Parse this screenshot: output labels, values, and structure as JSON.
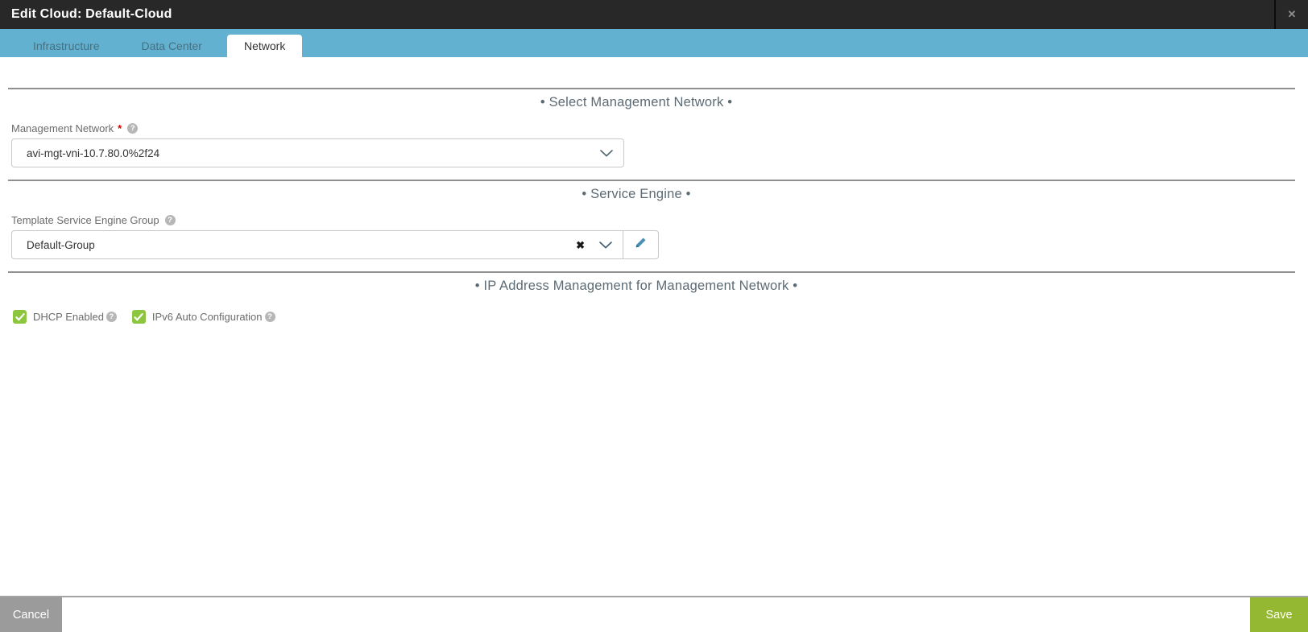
{
  "modal": {
    "title": "Edit Cloud: Default-Cloud"
  },
  "icons": {
    "close": "✕",
    "clear": "✖",
    "help": "?"
  },
  "tabs": [
    {
      "label": "Infrastructure",
      "active": false
    },
    {
      "label": "Data Center",
      "active": false
    },
    {
      "label": "Network",
      "active": true
    }
  ],
  "sections": {
    "select_management_network": {
      "heading": "• Select Management Network •",
      "field": {
        "label": "Management Network",
        "required_marker": "*",
        "value": "avi-mgt-vni-10.7.80.0%2f24"
      }
    },
    "service_engine": {
      "heading": "• Service Engine •",
      "field": {
        "label": "Template Service Engine Group",
        "value": "Default-Group"
      }
    },
    "ip_address_management": {
      "heading": "• IP Address Management for Management Network •",
      "checkboxes": [
        {
          "label": "DHCP Enabled",
          "checked": true
        },
        {
          "label": "IPv6 Auto Configuration",
          "checked": true
        }
      ]
    }
  },
  "footer": {
    "cancel_label": "Cancel",
    "save_label": "Save"
  },
  "colors": {
    "titlebar_bg": "#282828",
    "tabbar_bg": "#63b1d1",
    "active_tab_bg": "#ffffff",
    "checkbox_green": "#8cc63f",
    "save_green": "#95b832",
    "cancel_gray": "#9b9b9b",
    "required_red": "#d40000",
    "pencil_blue": "#4a8fb5"
  }
}
